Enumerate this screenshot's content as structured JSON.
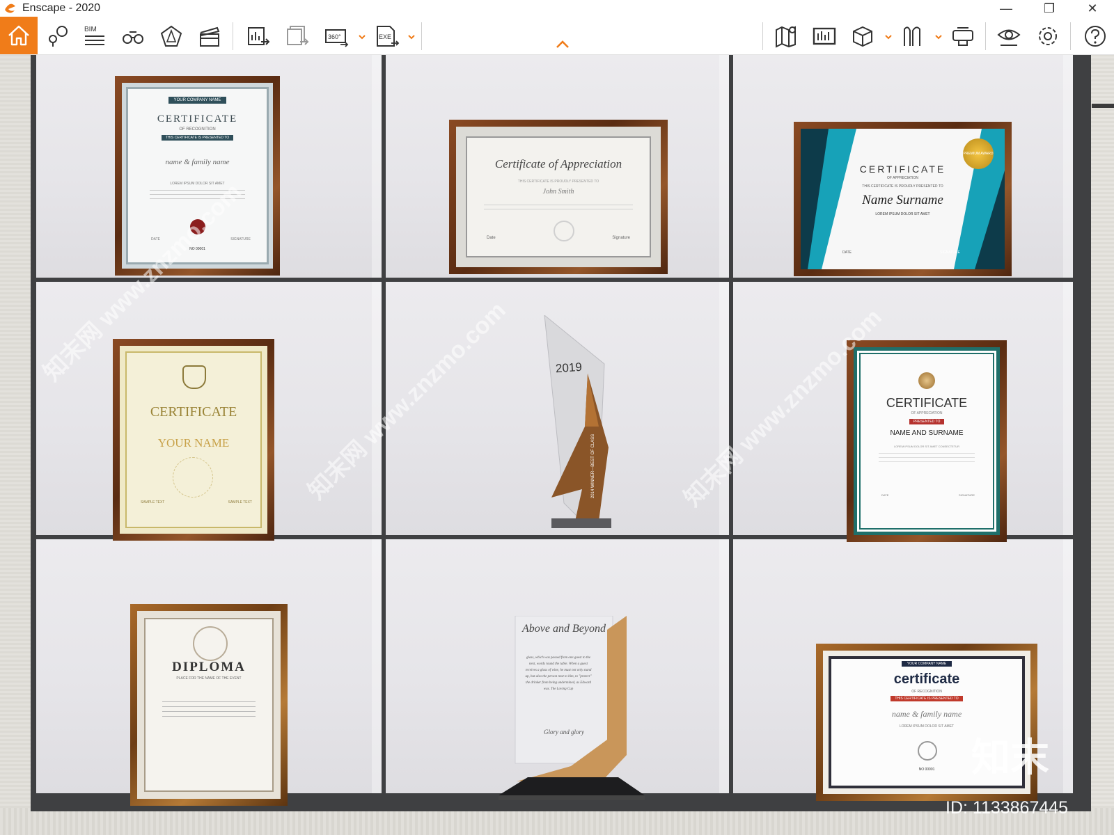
{
  "window": {
    "title": "Enscape - 2020",
    "controls": [
      "—",
      "❐",
      "✕"
    ]
  },
  "toolbar": {
    "bim_label": "BIM",
    "pano_label": "360°",
    "exe_label": "EXE",
    "accent_color": "#f07c19",
    "icons": [
      "home-icon",
      "link-views-icon",
      "bim-icon",
      "binoculars-icon",
      "perspective-icon",
      "clapper-icon",
      "screenshot-export-icon",
      "batch-render-icon",
      "panorama-360-icon",
      "exe-export-icon",
      "map-icon",
      "asset-library-icon",
      "box-icon",
      "material-icon",
      "vr-headset-icon",
      "visibility-icon",
      "settings-icon",
      "help-icon"
    ]
  },
  "scene": {
    "certificates": {
      "c1": {
        "banner": "YOUR COMPANY NAME",
        "title": "CERTIFICATE",
        "subtitle": "OF RECOGNITION",
        "presented": "THIS CERTIFICATE IS PRESENTED TO",
        "name": "name & family name",
        "lorem": "LOREM IPSUM DOLOR SIT AMET",
        "date": "DATE",
        "signature": "SIGNATURE",
        "number": "NO 00001"
      },
      "c2": {
        "title": "Certificate of Appreciation",
        "presented": "THIS CERTIFICATE IS PROUDLY PRESENTED TO",
        "name": "John Smith",
        "date": "Date",
        "signature": "Signature"
      },
      "c3": {
        "title": "CERTIFICATE",
        "subtitle": "OF APPRECIATION",
        "presented": "THIS CERTIFICATE IS PROUDLY PRESENTED TO",
        "name": "Name Surname",
        "lorem": "LOREM IPSUM DOLOR SIT AMET",
        "date": "DATE",
        "signature": "SIGNATURE",
        "seal": "PREMIUM AWARD"
      },
      "c4": {
        "title": "CERTIFICATE",
        "name": "YOUR NAME",
        "sample1": "SAMPLE TEXT",
        "sample2": "SAMPLE TEXT"
      },
      "c5": {
        "title": "CERTIFICATE",
        "subtitle": "OF APPRECIATION",
        "presented": "PRESENTED TO",
        "name": "NAME AND SURNAME",
        "lorem": "LOREM IPSUM DOLOR SIT AMET CONSECTETUR",
        "date": "DATE",
        "signature": "SIGNATURE"
      },
      "c6": {
        "title": "DIPLOMA",
        "subtitle": "PLACE FOR THE NAME OF THE EVENT"
      },
      "c7": {
        "banner": "YOUR COMPANY NAME",
        "title": "certificate",
        "subtitle": "OF RECOGNITION",
        "presented": "THIS CERTIFICATE IS PRESENTED TO",
        "name": "name & family name",
        "lorem": "LOREM IPSUM DOLOR SIT AMET",
        "number": "NO 00001"
      }
    },
    "trophy1": {
      "year": "2019",
      "plate": "2014 WINNER—BEST OF CLASS"
    },
    "trophy2": {
      "title": "Above and Beyond",
      "body": "glass, which was passed from one guest to the next, words round the table. When a guest receives a glass of wine, he must not only stand up, but also the person next to him, to \"protect\" the drinker from being undermined, as Edward was. The Loving Cup",
      "footer": "Glory and glory"
    },
    "watermarks": [
      "知末网 www.znzmo.com"
    ],
    "brand_mark": "知末",
    "image_id": "ID: 1133867445"
  }
}
